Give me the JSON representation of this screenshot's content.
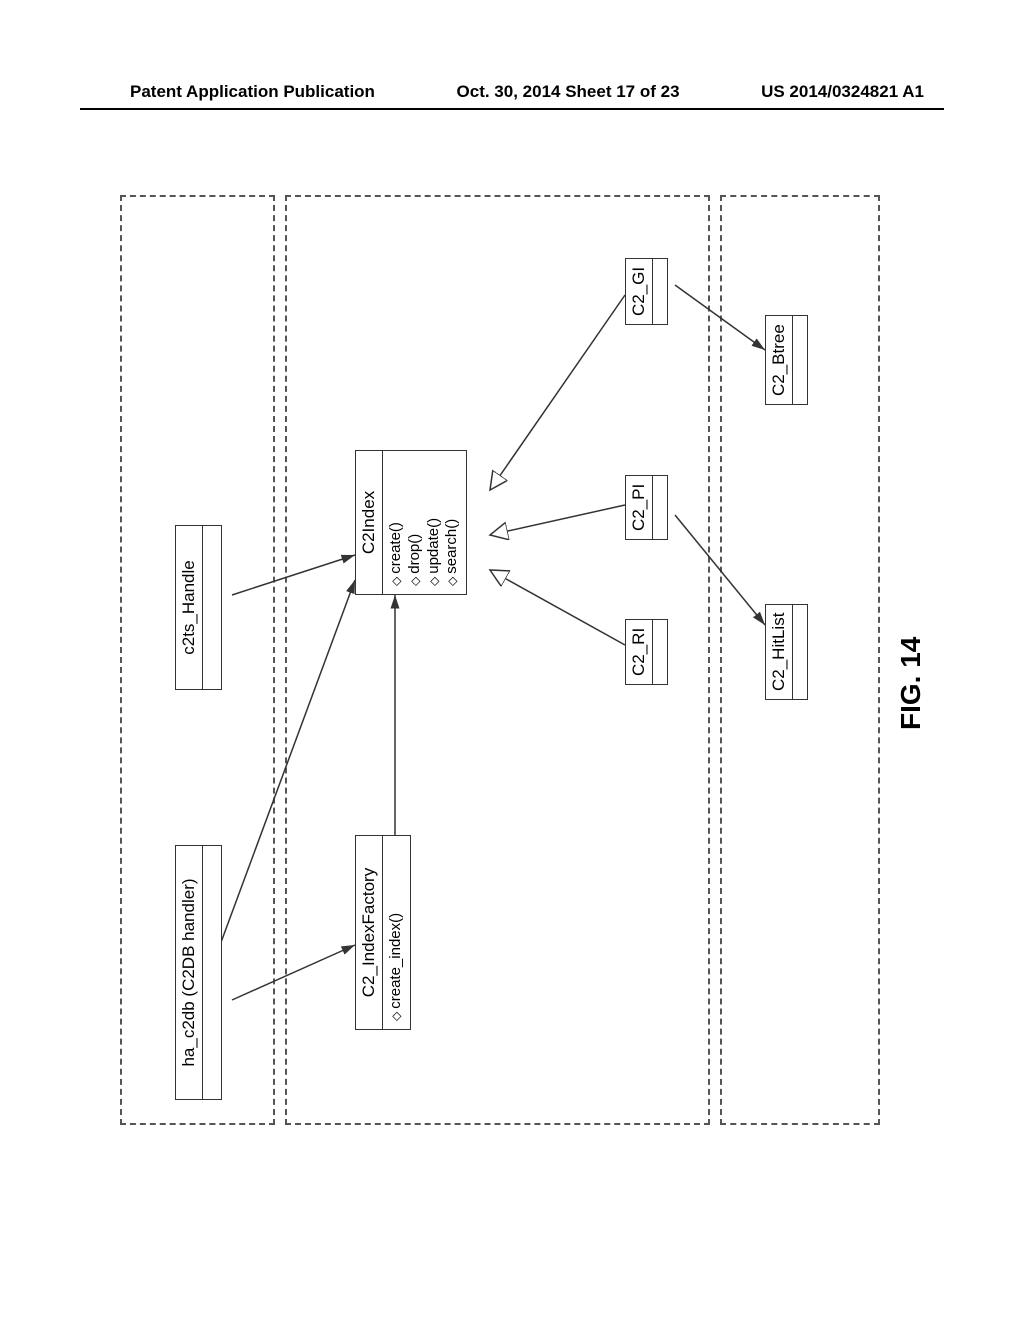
{
  "header": {
    "left": "Patent Application Publication",
    "middle": "Oct. 30, 2014  Sheet 17 of 23",
    "right": "US 2014/0324821 A1"
  },
  "figure_label": "FIG. 14",
  "boxes": {
    "ha_c2db": {
      "title": "ha_c2db (C2DB handler)"
    },
    "c2ts_handle": {
      "title": "c2ts_Handle"
    },
    "c2_indexfactory": {
      "title": "C2_IndexFactory",
      "methods": [
        "create_index()"
      ]
    },
    "c2index": {
      "title": "C2Index",
      "methods": [
        "create()",
        "drop()",
        "update()",
        "search()"
      ]
    },
    "c2_ri": {
      "title": "C2_RI"
    },
    "c2_pi": {
      "title": "C2_PI"
    },
    "c2_gi": {
      "title": "C2_GI"
    },
    "c2_hitlist": {
      "title": "C2_HitList"
    },
    "c2_btree": {
      "title": "C2_Btree"
    }
  }
}
